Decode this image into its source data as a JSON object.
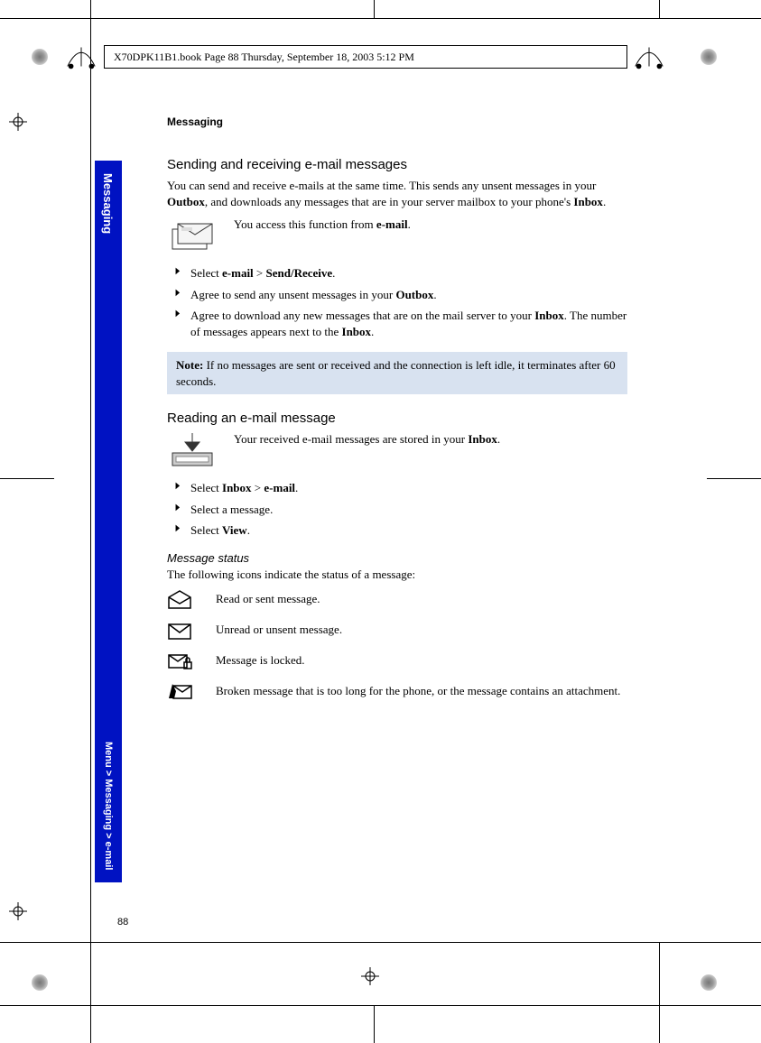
{
  "header": {
    "text": "X70DPK11B1.book  Page 88  Thursday, September 18, 2003  5:12 PM"
  },
  "sideTab": {
    "top": "Messaging",
    "bottom": "Menu > Messaging > e-mail"
  },
  "section": "Messaging",
  "h1": "Sending and receiving e-mail messages",
  "p1_a": "You can send and receive e-mails at the same time. This sends any unsent messages in your ",
  "p1_b": "Outbox",
  "p1_c": ", and downloads any messages that are in your server mailbox to your phone's ",
  "p1_d": "Inbox",
  "p1_e": ".",
  "p2_a": "You access this function from ",
  "p2_b": "e-mail",
  "p2_c": ".",
  "list1": {
    "i1_a": "Select ",
    "i1_b": "e-mail",
    "i1_c": " > ",
    "i1_d": "Send/Receive",
    "i1_e": ".",
    "i2_a": "Agree to send any unsent messages in your ",
    "i2_b": "Outbox",
    "i2_c": ".",
    "i3_a": "Agree to download any new messages that are on the mail server to your ",
    "i3_b": "Inbox",
    "i3_c": ". The number of messages appears next to the ",
    "i3_d": "Inbox",
    "i3_e": "."
  },
  "note_label": "Note:",
  "note_text": " If no messages are sent or received and the connection is left idle, it terminates after 60 seconds.",
  "h2": "Reading an e-mail message",
  "p3_a": "Your received e-mail messages are stored in your ",
  "p3_b": "Inbox",
  "p3_c": ".",
  "list2": {
    "i1_a": "Select ",
    "i1_b": "Inbox",
    "i1_c": " > ",
    "i1_d": "e-mail",
    "i1_e": ".",
    "i2": "Select a message.",
    "i3_a": "Select ",
    "i3_b": "View",
    "i3_c": "."
  },
  "subheading": "Message status",
  "p4": "The following icons indicate the status of a message:",
  "status": {
    "s1": "Read or sent message.",
    "s2": "Unread or unsent message.",
    "s3": "Message is locked.",
    "s4": "Broken message that is too long for the phone, or the message contains an attachment."
  },
  "pageNumber": "88"
}
